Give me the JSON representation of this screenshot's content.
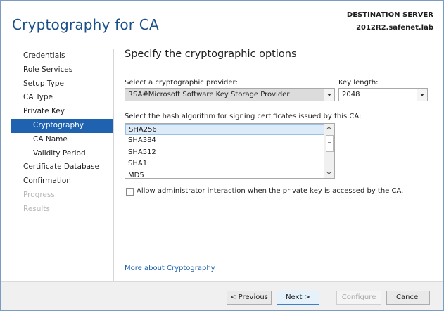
{
  "header": {
    "title": "Cryptography for CA",
    "destination_label": "DESTINATION SERVER",
    "destination_server": "2012R2.safenet.lab"
  },
  "nav": {
    "items": [
      {
        "label": "Credentials",
        "state": "normal"
      },
      {
        "label": "Role Services",
        "state": "normal"
      },
      {
        "label": "Setup Type",
        "state": "normal"
      },
      {
        "label": "CA Type",
        "state": "normal"
      },
      {
        "label": "Private Key",
        "state": "normal"
      },
      {
        "label": "Cryptography",
        "state": "active"
      },
      {
        "label": "CA Name",
        "state": "normal"
      },
      {
        "label": "Validity Period",
        "state": "normal"
      },
      {
        "label": "Certificate Database",
        "state": "normal"
      },
      {
        "label": "Confirmation",
        "state": "normal"
      },
      {
        "label": "Progress",
        "state": "disabled"
      },
      {
        "label": "Results",
        "state": "disabled"
      }
    ]
  },
  "main": {
    "section_title": "Specify the cryptographic options",
    "provider_label": "Select a cryptographic provider:",
    "provider_value": "RSA#Microsoft Software Key Storage Provider",
    "key_length_label": "Key length:",
    "key_length_value": "2048",
    "hash_label": "Select the hash algorithm for signing certificates issued by this CA:",
    "hash_options": [
      "SHA256",
      "SHA384",
      "SHA512",
      "SHA1",
      "MD5"
    ],
    "hash_selected": "SHA256",
    "checkbox_label": "Allow administrator interaction when the private key is accessed by the CA.",
    "checkbox_checked": false,
    "more_link": "More about Cryptography"
  },
  "footer": {
    "previous": "< Previous",
    "next": "Next >",
    "configure": "Configure",
    "cancel": "Cancel"
  }
}
